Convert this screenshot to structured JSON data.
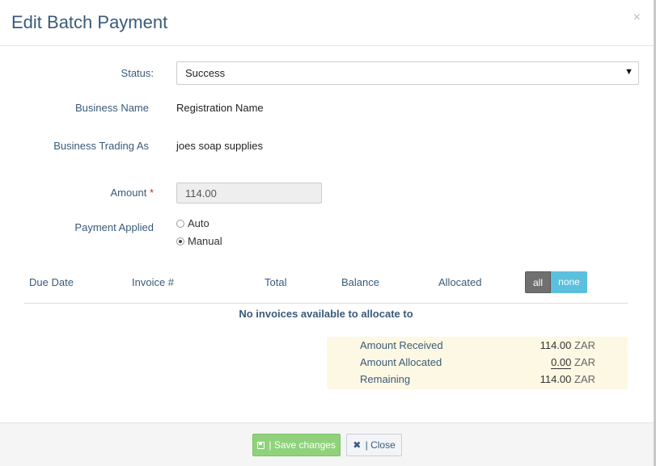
{
  "modal": {
    "title": "Edit Batch Payment",
    "close_glyph": "×"
  },
  "form": {
    "status_label": "Status:",
    "status_value": "Success",
    "business_name_label": "Business Name",
    "business_name_value": "Registration Name",
    "trading_as_label": "Business Trading As",
    "trading_as_value": "joes soap supplies",
    "amount_label": "Amount",
    "amount_required_mark": "*",
    "amount_value": "114.00",
    "payment_applied_label": "Payment Applied",
    "payment_options": [
      {
        "label": "Auto",
        "checked": false
      },
      {
        "label": "Manual",
        "checked": true
      }
    ]
  },
  "table": {
    "headers": [
      "Due Date",
      "Invoice #",
      "Total",
      "Balance",
      "Allocated"
    ],
    "toggle_all": "all",
    "toggle_none": "none",
    "empty_message": "No invoices available to allocate to"
  },
  "summary": {
    "rows": [
      {
        "label": "Amount Received",
        "value": "114.00",
        "currency": "ZAR"
      },
      {
        "label": "Amount Allocated",
        "value": "0.00",
        "currency": "ZAR"
      },
      {
        "label": "Remaining",
        "value": "114.00",
        "currency": "ZAR"
      }
    ]
  },
  "footer": {
    "save_label": "| Save changes",
    "close_label": "| Close",
    "save_icon": "floppy-disk-icon",
    "close_icon": "x-icon"
  },
  "colors": {
    "label_blue": "#3a5a7a",
    "save_green": "#8fd27b",
    "toggle_none_blue": "#5bc0de",
    "summary_bg": "#fcf8e3"
  }
}
